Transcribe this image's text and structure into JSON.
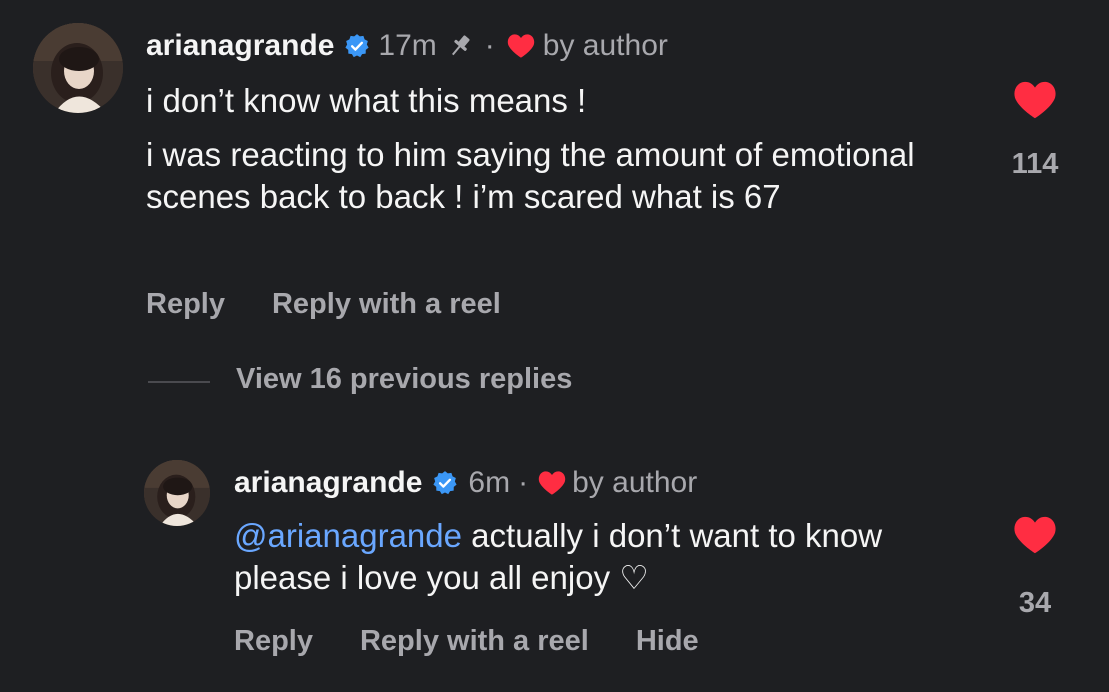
{
  "colors": {
    "background": "#1e1f22",
    "heart": "#ff2d42",
    "verified": "#3b97f6",
    "mention": "#6aa7ff",
    "muted": "#a8a8ad"
  },
  "comment": {
    "username": "arianagrande",
    "time": "17m",
    "separator": "·",
    "liked_by": "by author",
    "line1": "i don’t know what this means !",
    "paragraph": "i was reacting to him saying the amount of emotional scenes back to back ! i’m scared what is 67",
    "reply_label": "Reply",
    "reply_reel_label": "Reply with a reel",
    "like_count": "114",
    "icons": [
      "verified-badge-icon",
      "pin-icon",
      "heart-icon"
    ]
  },
  "view_replies": "View 16 previous replies",
  "reply": {
    "username": "arianagrande",
    "time": "6m",
    "separator": "·",
    "liked_by": "by author",
    "mention": "@arianagrande",
    "text": " actually i don’t want to know please i love you all enjoy ♡",
    "reply_label": "Reply",
    "reply_reel_label": "Reply with a reel",
    "hide_label": "Hide",
    "like_count": "34",
    "icons": [
      "verified-badge-icon",
      "heart-icon"
    ]
  }
}
